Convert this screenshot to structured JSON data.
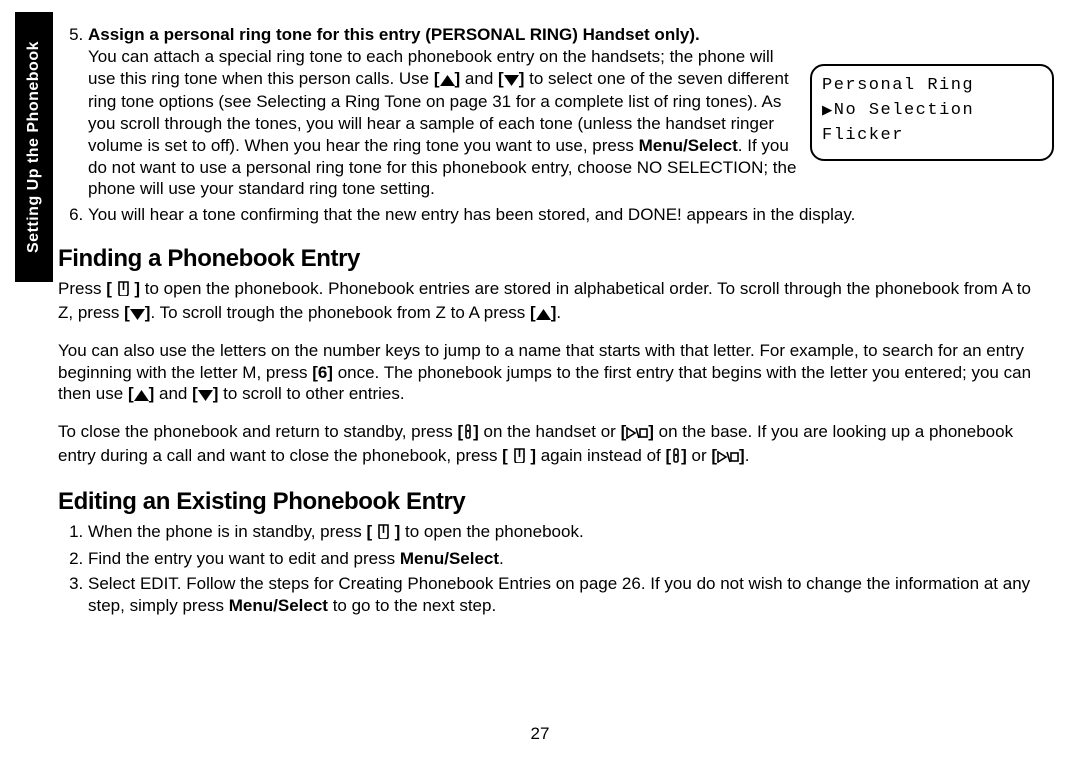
{
  "side_tab": "Setting Up the Phonebook",
  "step5": {
    "number": "5",
    "heading": "Assign a personal ring tone for this entry (PERSONAL RING) Handset only).",
    "body_a": "You can attach a special ring tone to each phonebook entry on the handsets; the phone will use this ring tone when this person calls. Use ",
    "body_b": " and ",
    "body_c": " to select one of the seven different ring tone options (see Selecting a Ring Tone on page 31 for a complete list of ring tones). As you scroll through the tones, you will hear a sample of each tone (unless the handset ringer volume is set to off). When you hear the ring tone you want to use, press ",
    "menu_select": "Menu/Select",
    "body_d": ". If you do not want to use a personal ring tone for this phonebook entry, choose NO SELECTION; the phone will use your standard ring tone setting."
  },
  "step6": {
    "number": "6",
    "text": "You will hear a tone confirming that the new entry has been stored, and DONE! appears in the display."
  },
  "lcd": {
    "line1": "Personal Ring",
    "line2": "No Selection",
    "line3": "Flicker"
  },
  "finding": {
    "heading": "Finding a Phonebook Entry",
    "p1_a": "Press ",
    "p1_b": " to open the phonebook. Phonebook entries are stored in alphabetical order. To scroll through the phonebook from A to Z, press ",
    "p1_c": ". To scroll trough the phonebook from Z to A press ",
    "p1_d": ".",
    "p2_a": "You can also use the letters on the number keys to jump to a name that starts with that letter. For example, to search for an entry beginning with the letter M, press ",
    "key6": "[6]",
    "p2_b": " once. The phonebook jumps to the first entry that begins with the letter you entered; you can then use ",
    "p2_c": " and ",
    "p2_d": " to scroll to other entries.",
    "p3_a": "To close the phonebook and return to standby, press ",
    "p3_b": " on the handset or ",
    "p3_c": " on the base. If you are looking up a phonebook entry during a call and want to close the phonebook, press ",
    "p3_d": " again instead of ",
    "p3_e": " or ",
    "p3_f": "."
  },
  "editing": {
    "heading": "Editing an Existing Phonebook Entry",
    "s1_a": "When the phone is in standby, press ",
    "s1_b": " to open the phonebook.",
    "s2_a": "Find the entry you want to edit and press ",
    "s2_b": ".",
    "s3_a": "Select EDIT. Follow the steps for Creating Phonebook Entries on page 26. If you do not wish to change the information at any step, simply press ",
    "s3_b": " to go to the next step."
  },
  "page_number": "27",
  "glyphs": {
    "bracket_open": "[",
    "bracket_close": "]"
  }
}
